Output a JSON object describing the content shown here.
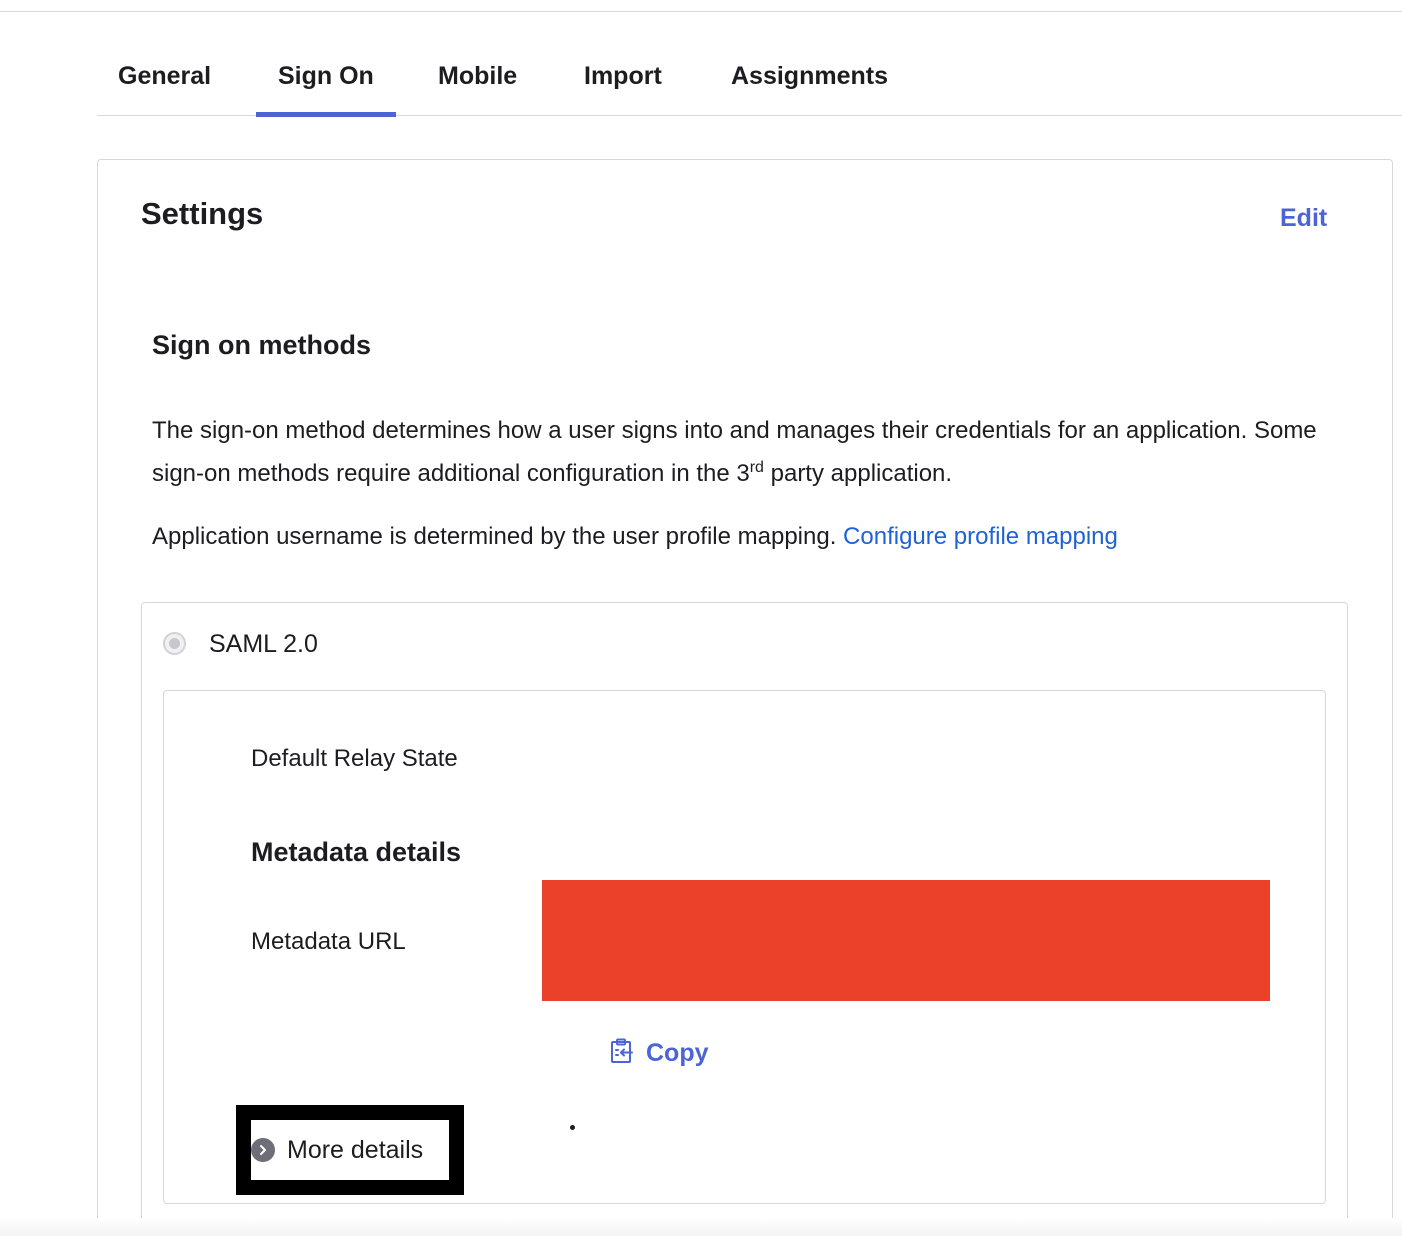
{
  "tabs": [
    {
      "label": "General"
    },
    {
      "label": "Sign On",
      "active": true
    },
    {
      "label": "Mobile"
    },
    {
      "label": "Import"
    },
    {
      "label": "Assignments"
    }
  ],
  "settings": {
    "title": "Settings",
    "edit_label": "Edit"
  },
  "sign_on_methods": {
    "title": "Sign on methods",
    "description_part1": "The sign-on method determines how a user signs into and manages their credentials for an application. Some sign-on methods require additional configuration in the 3",
    "description_sup": "rd",
    "description_part2": " party application.",
    "mapping_text": "Application username is determined by the user profile mapping.",
    "mapping_link": "Configure profile mapping"
  },
  "saml": {
    "label": "SAML 2.0",
    "default_relay_state_label": "Default Relay State",
    "metadata_title": "Metadata details",
    "metadata_url_label": "Metadata URL",
    "copy_label": "Copy",
    "more_details_label": "More details"
  },
  "colors": {
    "accent": "#4c64d6",
    "link": "#1f62d6",
    "redaction": "#ea4128"
  },
  "icons": {
    "copy": "clipboard-icon",
    "more_details": "chevron-right-circle-icon"
  }
}
